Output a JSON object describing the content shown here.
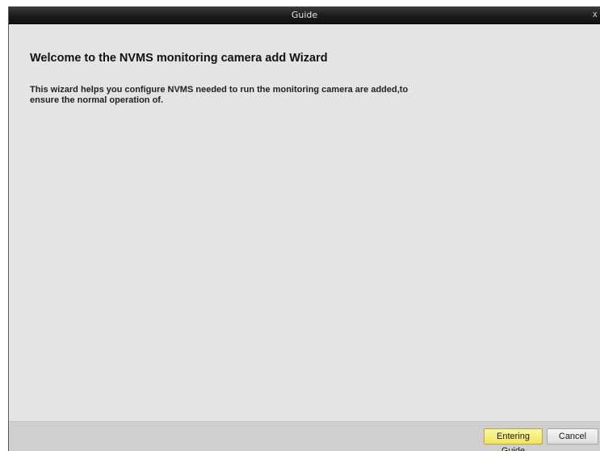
{
  "window": {
    "title": "Guide",
    "close_label": "x"
  },
  "content": {
    "heading": "Welcome to the NVMS  monitoring camera add Wizard",
    "description": "This wizard helps you configure NVMS  needed to run the monitoring camera are added,to ensure the normal operation of."
  },
  "footer": {
    "entering_guide_label": "Entering Guide",
    "cancel_label": "Cancel"
  },
  "colors": {
    "titlebar": "#1b1b1b",
    "body": "#e4e4e4",
    "footer": "#cfcfcf",
    "primary_button": "#f0e65a"
  }
}
